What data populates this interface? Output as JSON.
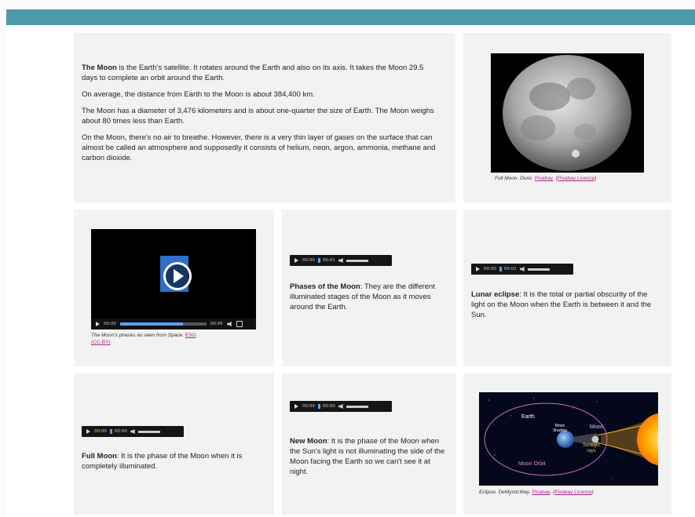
{
  "moon_intro": {
    "p1_strong": "The Moon",
    "p1_rest": " is the Earth's satellite. It rotates around the Earth and also on its axis. It takes the Moon 29.5 days to complete an orbit around the Earth.",
    "p2": "On average, the distance from Earth to the Moon is about 384,400 km.",
    "p3": "The Moon has a diameter of 3,476 kilometers and is about one-quarter the size of Earth. The Moon weighs about 80 times less than Earth.",
    "p4": "On the Moon, there's no air to breathe. However, there is a very thin layer of gases on the surface that can almost be called an atmosphere and supposedly it consists of helium, neon, argon, ammonia, methane and carbon dioxide."
  },
  "full_moon_image": {
    "caption_prefix": "Full Moon. Dunc. ",
    "link1": "Pixabay",
    "mid": ", (",
    "link2": "Pixabay Licence",
    "end": ")"
  },
  "video": {
    "time_current": "00:00",
    "time_total": "00:45",
    "caption_prefix": "The Moon's phases as seen from Space. ",
    "link1": "ESO",
    "mid": ". ",
    "link2": "(CC-BY)"
  },
  "phases": {
    "audio_current": "00:00",
    "audio_total": "00:01",
    "strong": "Phases of the Moon",
    "rest": ": They are the different illuminated stages of the Moon as it moves around the Earth."
  },
  "eclipse_text": {
    "audio_current": "00:00",
    "audio_total": "00:01",
    "strong": "Lunar eclipse",
    "rest": ": It is the total or partial obscurity of the light on the Moon when the Earth is between it and the Sun."
  },
  "full_moon": {
    "audio_current": "00:00",
    "audio_total": "00:00",
    "strong": "Full Moon",
    "rest": ": It is the phase of the Moon when it is completely illuminated."
  },
  "new_moon": {
    "audio_current": "00:00",
    "audio_total": "00:00",
    "strong": "New Moon",
    "rest": ": It is the phase of the Moon when the Sun's light is not illuminating the side of the Moon facing the Earth so we can't see it at night."
  },
  "eclipse_diagram": {
    "label_earth": "Earth",
    "label_moon_shadow": "Moon Shadow",
    "label_moon": "Moon",
    "label_sunlight": "Sunlight rays",
    "label_orbit": "Moon Orbit",
    "caption_prefix": "Eclipse. DeMysticWay. ",
    "link1": "Pixabay",
    "mid": ", (",
    "link2": "Pixabay Licence",
    "end": ")"
  },
  "colors": {
    "topbar": "#4d9aa6",
    "card": "#f2f2f2",
    "link": "#b3268a"
  }
}
